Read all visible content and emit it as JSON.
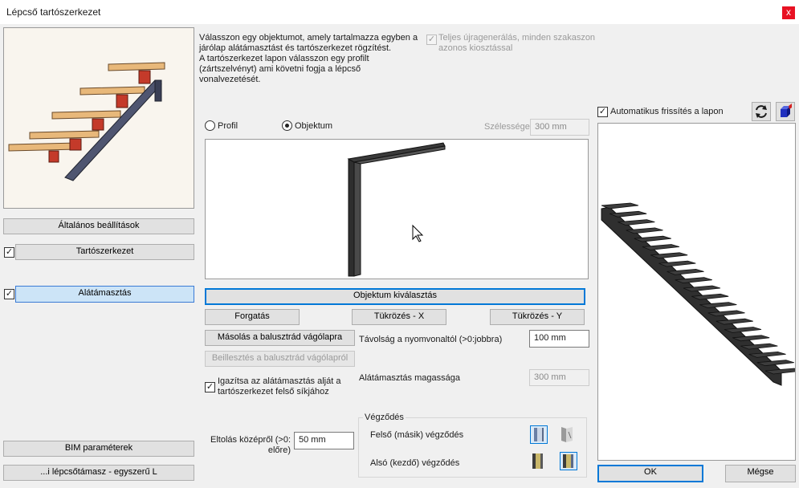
{
  "window": {
    "title": "Lépcső tartószerkezet",
    "close_glyph": "x"
  },
  "left": {
    "general_settings": "Általános beállítások",
    "tartoszerkezet": "Tartószerkezet",
    "alatamasztas": "Alátámasztás",
    "bim": "BIM paraméterek",
    "preset": "...i lépcsőtámasz - egyszerű L"
  },
  "main": {
    "description": [
      "Válasszon egy objektumot, amely tartalmazza egyben a",
      "járólap alátámasztást és tartószerkezet rögzítést.",
      "A tartószerkezet lapon válasszon egy profilt",
      "(zártszelvényt) ami követni fogja a lépcső",
      "vonalvezetését."
    ],
    "full_regen": [
      "Teljes újragenerálás, minden szakaszon",
      "azonos kiosztással"
    ],
    "radio_profil": "Profil",
    "radio_objektum": "Objektum",
    "width_label": "Szélessége",
    "width_value": "300 mm",
    "select_object": "Objektum kiválasztás",
    "rotate": "Forgatás",
    "mirror_x": "Tükrözés - X",
    "mirror_y": "Tükrözés - Y",
    "copy_clipboard": "Másolás a balusztrád vágólapra",
    "paste_clipboard": "Beillesztés a balusztrád vágólapról",
    "distance_label": "Távolság a nyomvonaltól (>0:jobbra)",
    "distance_value": "100 mm",
    "align_label": [
      "Igazítsa az alátámasztás alját a",
      "tartószerkezet felső síkjához"
    ],
    "height_label": "Alátámasztás magassága",
    "height_value": "300 mm",
    "offset_label": [
      "Eltolás középről (>0:",
      "előre)"
    ],
    "offset_value": "50 mm",
    "ending_group": "Végződés",
    "upper_end": "Felső (másik) végződés",
    "lower_end": "Alsó (kezdő) végződés"
  },
  "right": {
    "auto_refresh": "Automatikus frissítés a lapon",
    "refresh_icon": "refresh-icon",
    "cube_icon": "cube-icon"
  },
  "footer": {
    "ok": "OK",
    "cancel": "Mégse"
  },
  "colors": {
    "accent": "#0078d7",
    "tread": "#e8b87a",
    "support": "#c43a2a",
    "stringer": "#4f5570",
    "preview_bg": "#f9f5ee"
  }
}
